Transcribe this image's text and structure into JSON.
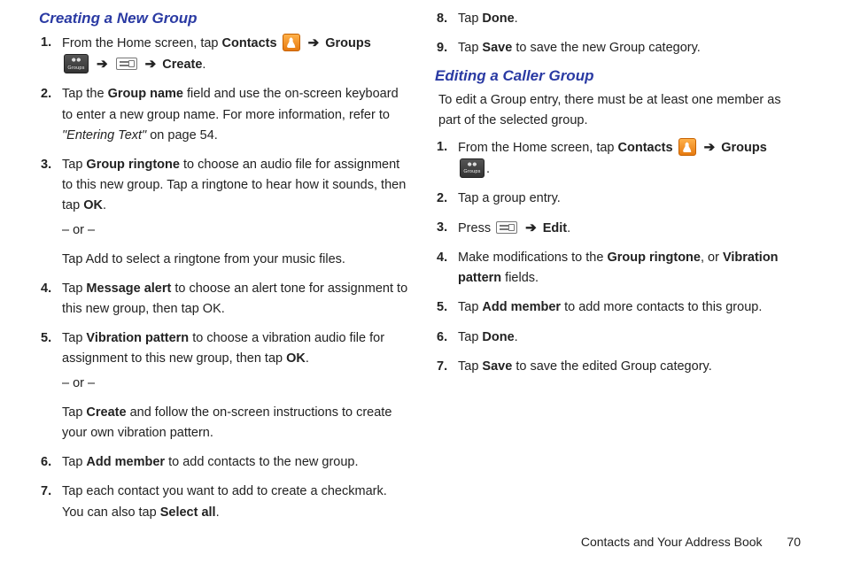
{
  "arrow": "➔",
  "left": {
    "heading": "Creating a New Group",
    "steps": {
      "s1": {
        "a": "From the Home screen, tap ",
        "contacts": "Contacts",
        "groups": "Groups",
        "create": "Create",
        "dot": "."
      },
      "s2": {
        "a": "Tap the ",
        "b": "Group name",
        "c": " field and use the on-screen keyboard to enter a new group name. For more information, refer to ",
        "d": "\"Entering Text\"",
        "e": " on page 54."
      },
      "s3": {
        "a": "Tap ",
        "b": "Group ringtone",
        "c": " to choose an audio file for assignment to this new group. Tap a ringtone to hear how it sounds, then tap ",
        "d": "OK",
        "e": ".",
        "or": "– or –",
        "f": "Tap Add to select a ringtone from your music files."
      },
      "s4": {
        "a": "Tap ",
        "b": "Message alert",
        "c": " to choose an alert tone for assignment to this new group, then tap OK."
      },
      "s5": {
        "a": "Tap ",
        "b": "Vibration pattern",
        "c": " to choose a vibration audio file for assignment to this new group, then tap ",
        "d": "OK",
        "e": ".",
        "or": "– or –",
        "f1": "Tap ",
        "f2": "Create",
        "f3": " and follow the on-screen instructions to create your own vibration pattern."
      },
      "s6": {
        "a": "Tap ",
        "b": "Add member",
        "c": " to add contacts to the new group."
      },
      "s7": {
        "a": "Tap each contact you want to add to create a checkmark. You can also tap ",
        "b": "Select all",
        "c": "."
      }
    }
  },
  "right": {
    "steps_pre": {
      "s8": {
        "a": "Tap ",
        "b": "Done",
        "c": "."
      },
      "s9": {
        "a": "Tap ",
        "b": "Save",
        "c": " to save the new Group category."
      }
    },
    "heading": "Editing a Caller Group",
    "intro": "To edit a Group entry, there must be at least one member as part of the selected group.",
    "steps": {
      "s1": {
        "a": "From the Home screen, tap ",
        "contacts": "Contacts",
        "groups": "Groups",
        "dot": "."
      },
      "s2": {
        "a": "Tap a group entry."
      },
      "s3": {
        "a": "Press ",
        "b": "Edit",
        "c": "."
      },
      "s4": {
        "a": "Make modifications to the ",
        "b": "Group ringtone",
        "c": ", or ",
        "d": "Vibration pattern",
        "e": " fields."
      },
      "s5": {
        "a": "Tap ",
        "b": "Add member",
        "c": " to add more contacts to this group."
      },
      "s6": {
        "a": "Tap ",
        "b": "Done",
        "c": "."
      },
      "s7": {
        "a": "Tap ",
        "b": "Save",
        "c": " to save the edited Group category."
      }
    }
  },
  "footer": {
    "section": "Contacts and Your Address Book",
    "page": "70"
  }
}
